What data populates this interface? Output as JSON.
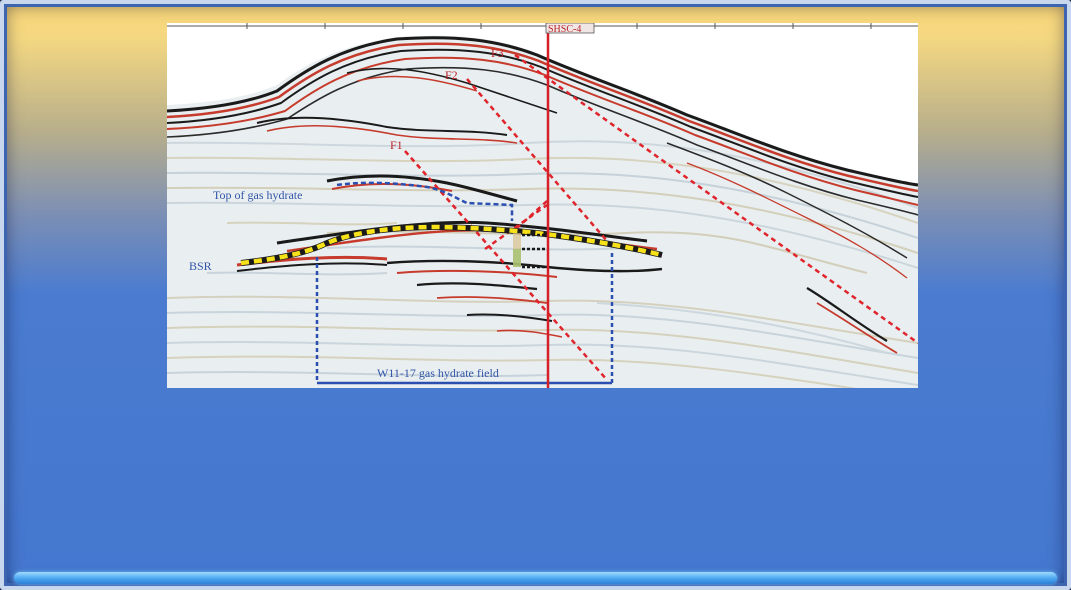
{
  "labels": {
    "well": "SHSC-4",
    "fault_f1": "F1",
    "fault_f2": "F2",
    "fault_f3": "F3",
    "top_gas_hydrate": "Top of gas hydrate",
    "bsr": "BSR",
    "field": "W11-17 gas hydrate field"
  },
  "colors": {
    "fault": "#e0242c",
    "well_line": "#d61f26",
    "bsr_marker": "#f7e21a",
    "field_box": "#2a4fb0",
    "label_red": "#b9252b",
    "label_blue": "#3155a8"
  }
}
